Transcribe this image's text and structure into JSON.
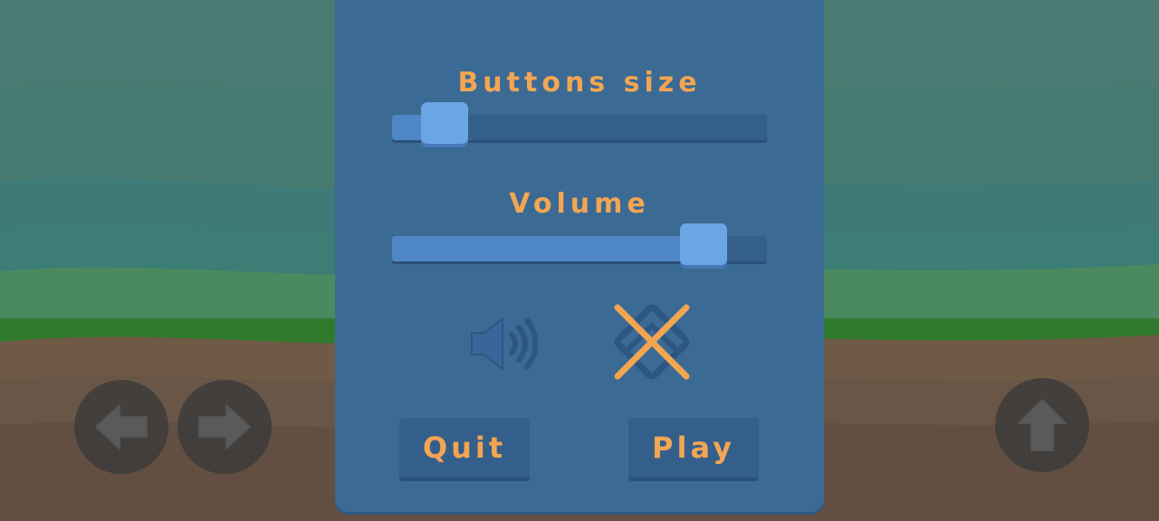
{
  "settings": {
    "buttons_size_label": "Buttons size",
    "buttons_size_value": 0.14,
    "volume_label": "Volume",
    "volume_value": 0.83
  },
  "menu": {
    "quit_label": "Quit",
    "play_label": "Play"
  },
  "icons": {
    "sound": "speaker-icon",
    "music_muted": "music-muted-icon",
    "left": "arrow-left-icon",
    "right": "arrow-right-icon",
    "jump": "arrow-up-icon"
  },
  "colors": {
    "panel": "#3b6a95",
    "accent_text": "#f2a552",
    "slider_fill": "#4f86c6",
    "slider_knob": "#6aa6e4"
  }
}
